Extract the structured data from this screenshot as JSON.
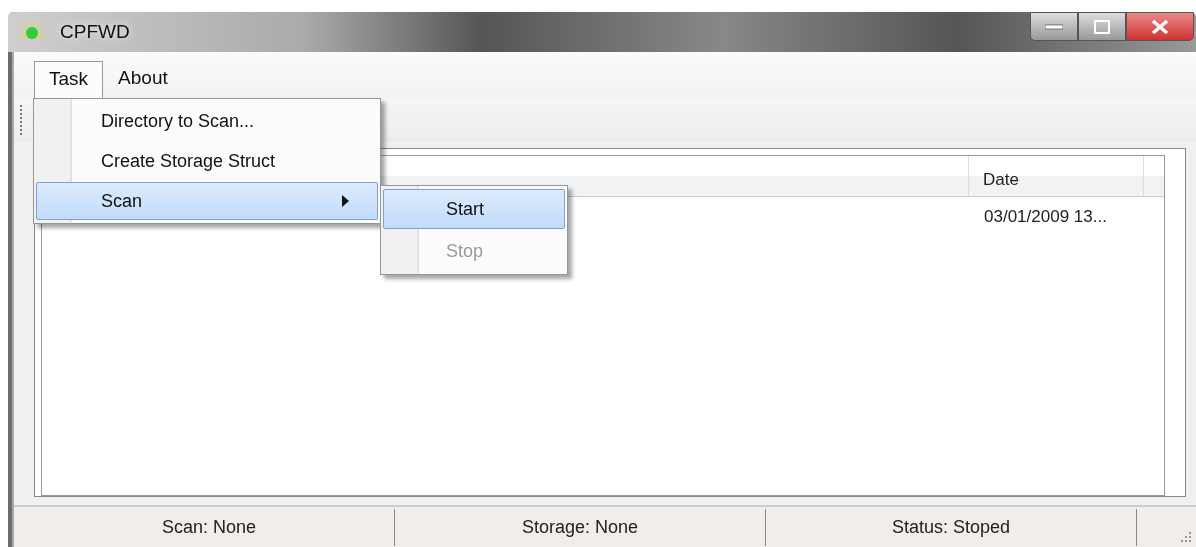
{
  "window": {
    "title": "CPFWD"
  },
  "menu_bar": [
    {
      "label": "Task",
      "selected": true
    },
    {
      "label": "About",
      "selected": false
    }
  ],
  "task_menu": [
    {
      "label": "Directory to Scan...",
      "selected": false,
      "kind": "item"
    },
    {
      "label": "Create Storage Struct",
      "selected": false,
      "kind": "item"
    },
    {
      "label": "Scan",
      "selected": true,
      "kind": "submenu"
    }
  ],
  "scan_submenu": [
    {
      "label": "Start",
      "selected": true,
      "disabled": false
    },
    {
      "label": "Stop",
      "selected": false,
      "disabled": true
    }
  ],
  "table": {
    "columns": [
      "Date"
    ],
    "rows": [
      [
        "03/01/2009 13..."
      ]
    ]
  },
  "status_bar": [
    "Scan: None",
    "Storage: None",
    "Status: Stoped"
  ]
}
